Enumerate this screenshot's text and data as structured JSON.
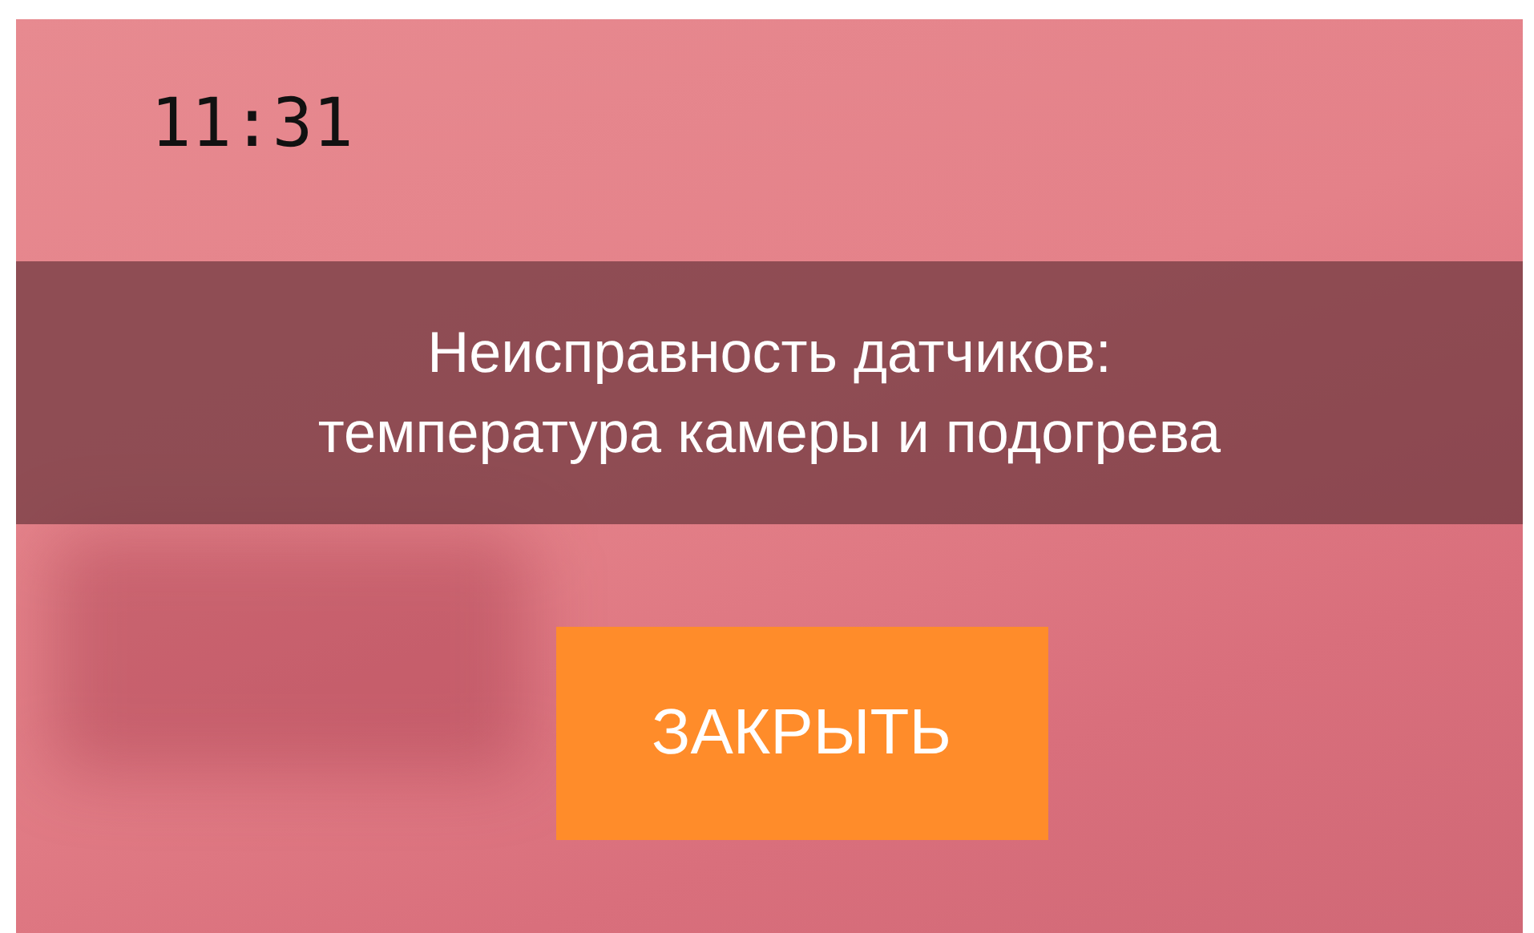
{
  "clock": {
    "time": "11:31"
  },
  "alert": {
    "lines": [
      "Неисправность датчиков:",
      "температура камеры и подогрева"
    ]
  },
  "buttons": [
    {
      "label": "ЗАКРЫТЬ"
    }
  ]
}
